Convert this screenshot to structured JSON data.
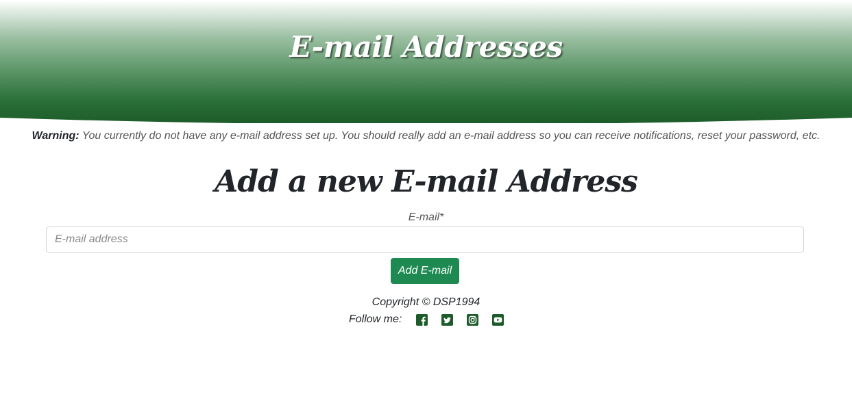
{
  "header": {
    "title": "E-mail Addresses"
  },
  "warning": {
    "label": "Warning:",
    "text": " You currently do not have any e-mail address set up. You should really add an e-mail address so you can receive notifications, reset your password, etc."
  },
  "form": {
    "title": "Add a new E-mail Address",
    "email_label": "E-mail*",
    "email_placeholder": "E-mail address",
    "email_value": "",
    "submit_label": "Add E-mail"
  },
  "footer": {
    "copyright": "Copyright © DSP1994",
    "follow_label": "Follow me:",
    "social_icons": [
      "facebook-icon",
      "twitter-icon",
      "instagram-icon",
      "youtube-icon"
    ]
  },
  "colors": {
    "brand_green": "#1d5c2a",
    "button_green": "#1e8a52"
  }
}
